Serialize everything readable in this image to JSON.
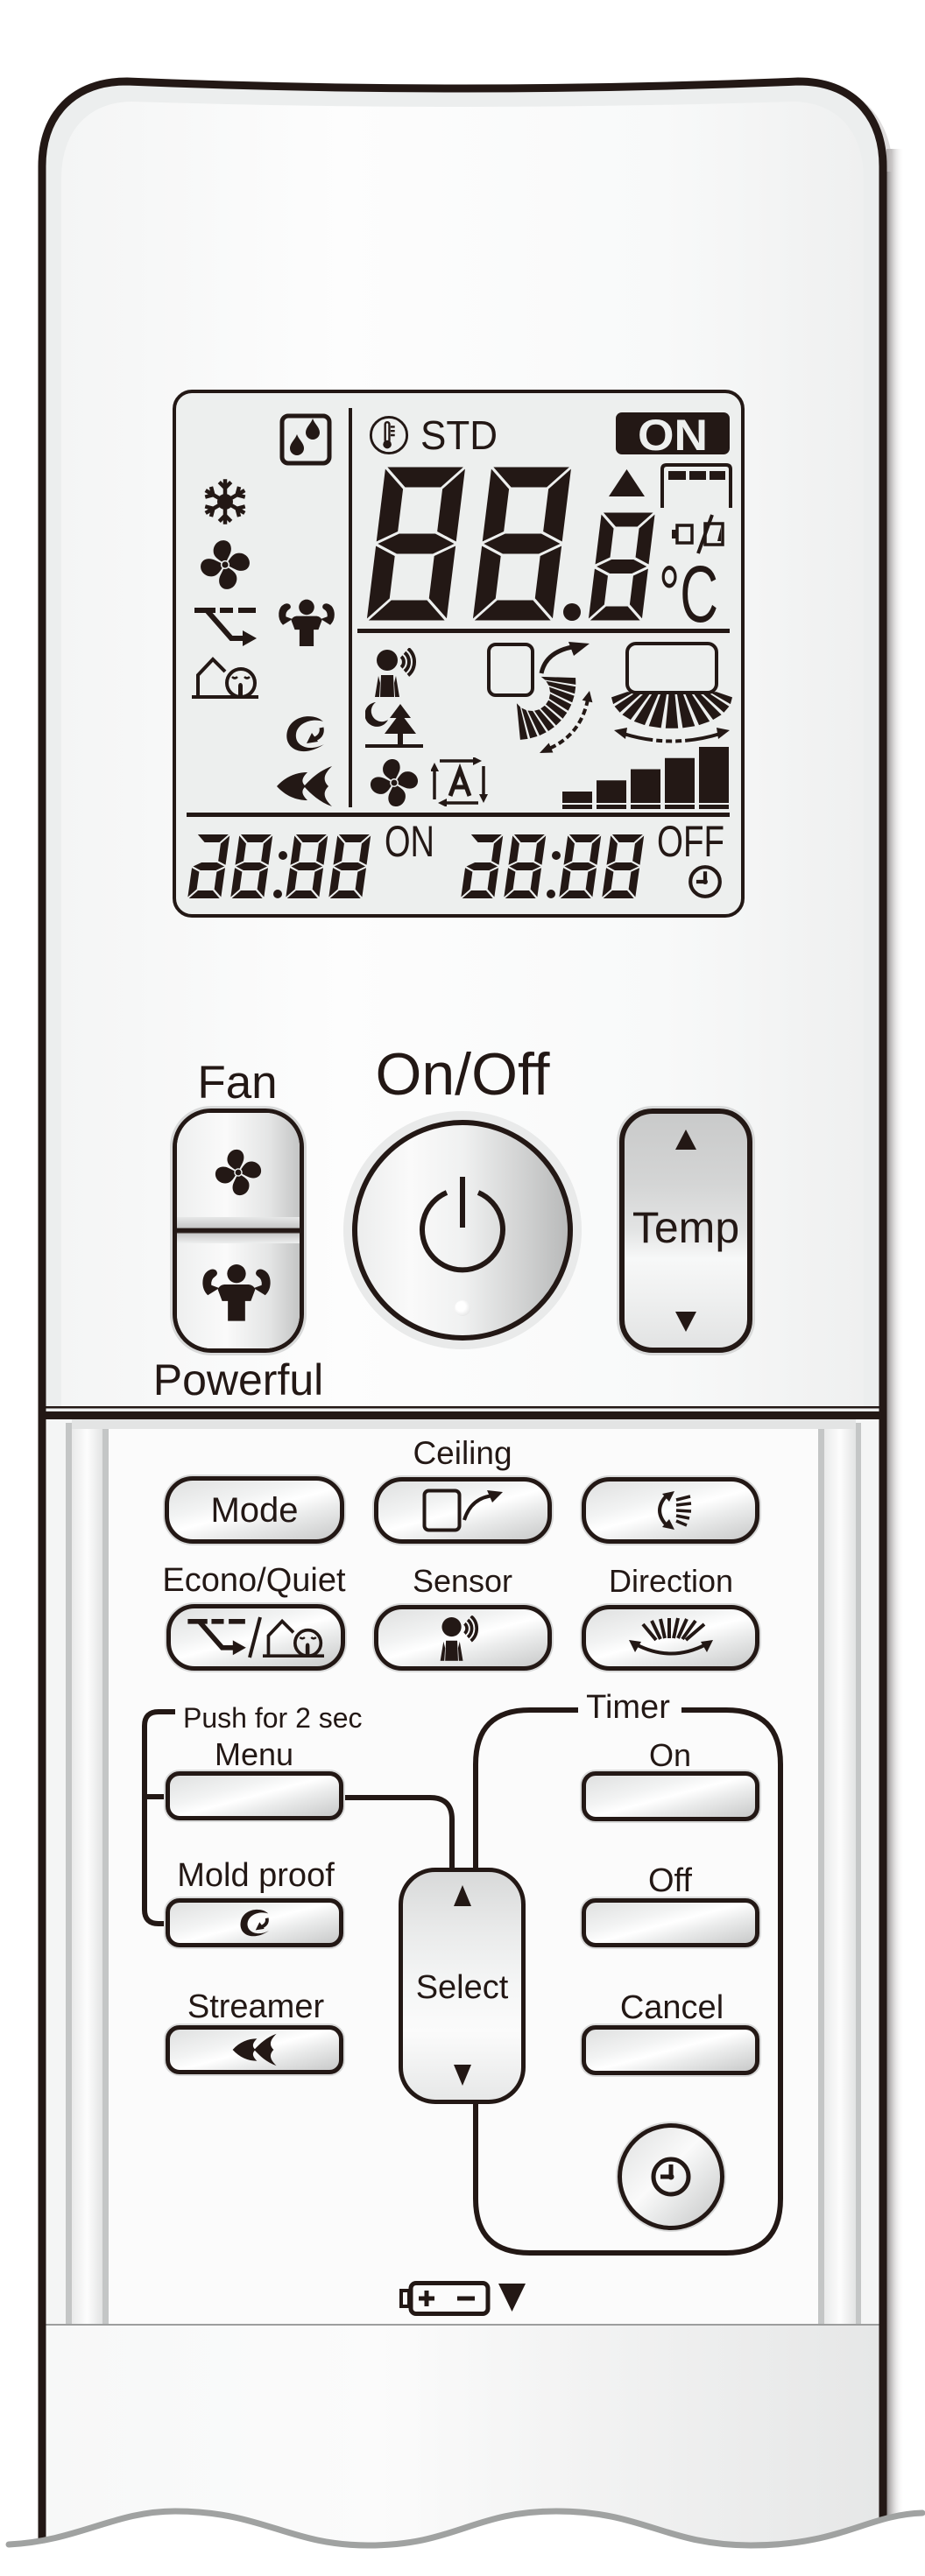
{
  "device": {
    "type": "air conditioner remote controller"
  },
  "lcd": {
    "comfort_label": "STD",
    "on_badge": "ON",
    "temperature": "88.8",
    "temperature_unit": "°C",
    "timer_on_time": "88:88",
    "timer_on_label": "ON",
    "timer_off_time": "88:88",
    "timer_off_label": "OFF",
    "fan_speed_level": 5,
    "fan_speed_max": 5,
    "icons": [
      "dry-mode-icon",
      "cool-mode-icon",
      "fan-mode-icon",
      "econo-icon",
      "powerful-icon",
      "quiet-icon",
      "mold-proof-icon",
      "streamer-icon",
      "thermostat-icon",
      "setpoint-up-icon",
      "room-display-icon",
      "battery-low-icon",
      "motion-sensor-icon",
      "night-mode-icon",
      "fan-auto-icon",
      "auto-airflow-icon",
      "vertical-swing-icon",
      "horizontal-swing-icon",
      "fan-speed-indicator",
      "clock-icon"
    ]
  },
  "buttons": {
    "fan": {
      "label": "Fan",
      "icon": "fan-icon"
    },
    "powerful": {
      "label": "Powerful",
      "icon": "powerful-icon"
    },
    "on_off": {
      "label": "On/Off",
      "icon": "power-icon"
    },
    "temp": {
      "label": "Temp",
      "up_icon": "triangle-up-icon",
      "down_icon": "triangle-down-icon"
    },
    "mode": {
      "label": "Mode"
    },
    "ceiling": {
      "label": "Ceiling",
      "icon": "ceiling-airflow-icon"
    },
    "swing": {
      "icon": "vertical-swing-icon"
    },
    "econo_quiet": {
      "label": "Econo/Quiet",
      "icon": "econo-quiet-icon"
    },
    "sensor": {
      "label": "Sensor",
      "icon": "motion-sensor-icon"
    },
    "direction": {
      "label": "Direction",
      "icon": "horizontal-swing-icon"
    },
    "menu": {
      "hint": "Push for 2 sec",
      "label": "Menu"
    },
    "mold_proof": {
      "label": "Mold proof",
      "icon": "mold-proof-icon"
    },
    "streamer": {
      "label": "Streamer",
      "icon": "streamer-icon"
    },
    "select": {
      "label": "Select",
      "up_icon": "triangle-up-icon",
      "down_icon": "triangle-down-icon"
    },
    "timer": {
      "group_label": "Timer",
      "on_label": "On",
      "off_label": "Off",
      "cancel_label": "Cancel",
      "clock_icon": "clock-icon"
    }
  },
  "battery_indicator": {
    "icon": "battery-icon",
    "pointer": "triangle-down-icon"
  },
  "colors": {
    "ink": "#231815",
    "lcd_background": "#edefee",
    "body": "#f6f7f7",
    "wave_outline": "#a0a2a1"
  }
}
